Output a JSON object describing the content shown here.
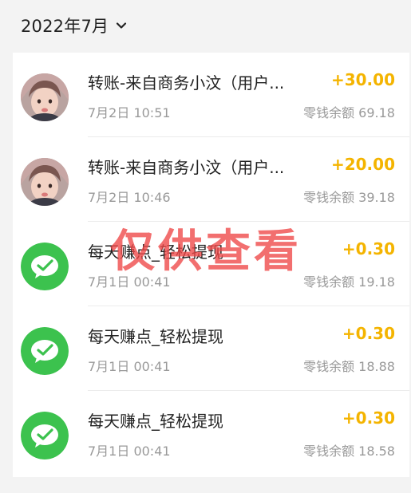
{
  "header": {
    "month": "2022年7月"
  },
  "transactions": [
    {
      "title": "转账-来自商务小汶（用户...",
      "time": "7月2日 10:51",
      "amount": "+30.00",
      "balance": "零钱余额 69.18",
      "avatar": "child-photo"
    },
    {
      "title": "转账-来自商务小汶（用户...",
      "time": "7月2日 10:46",
      "amount": "+20.00",
      "balance": "零钱余额 39.18",
      "avatar": "child-photo"
    },
    {
      "title": "每天赚点_轻松提现",
      "time": "7月1日 00:41",
      "amount": "+0.30",
      "balance": "零钱余额 19.18",
      "avatar": "wechat-icon"
    },
    {
      "title": "每天赚点_轻松提现",
      "time": "7月1日 00:41",
      "amount": "+0.30",
      "balance": "零钱余额 18.88",
      "avatar": "wechat-icon"
    },
    {
      "title": "每天赚点_轻松提现",
      "time": "7月1日 00:41",
      "amount": "+0.30",
      "balance": "零钱余额 18.58",
      "avatar": "wechat-icon"
    }
  ],
  "watermark": "仅供查看",
  "colors": {
    "amount": "#f4b400",
    "wechat_green": "#3cc24e",
    "watermark": "#ee4646"
  }
}
